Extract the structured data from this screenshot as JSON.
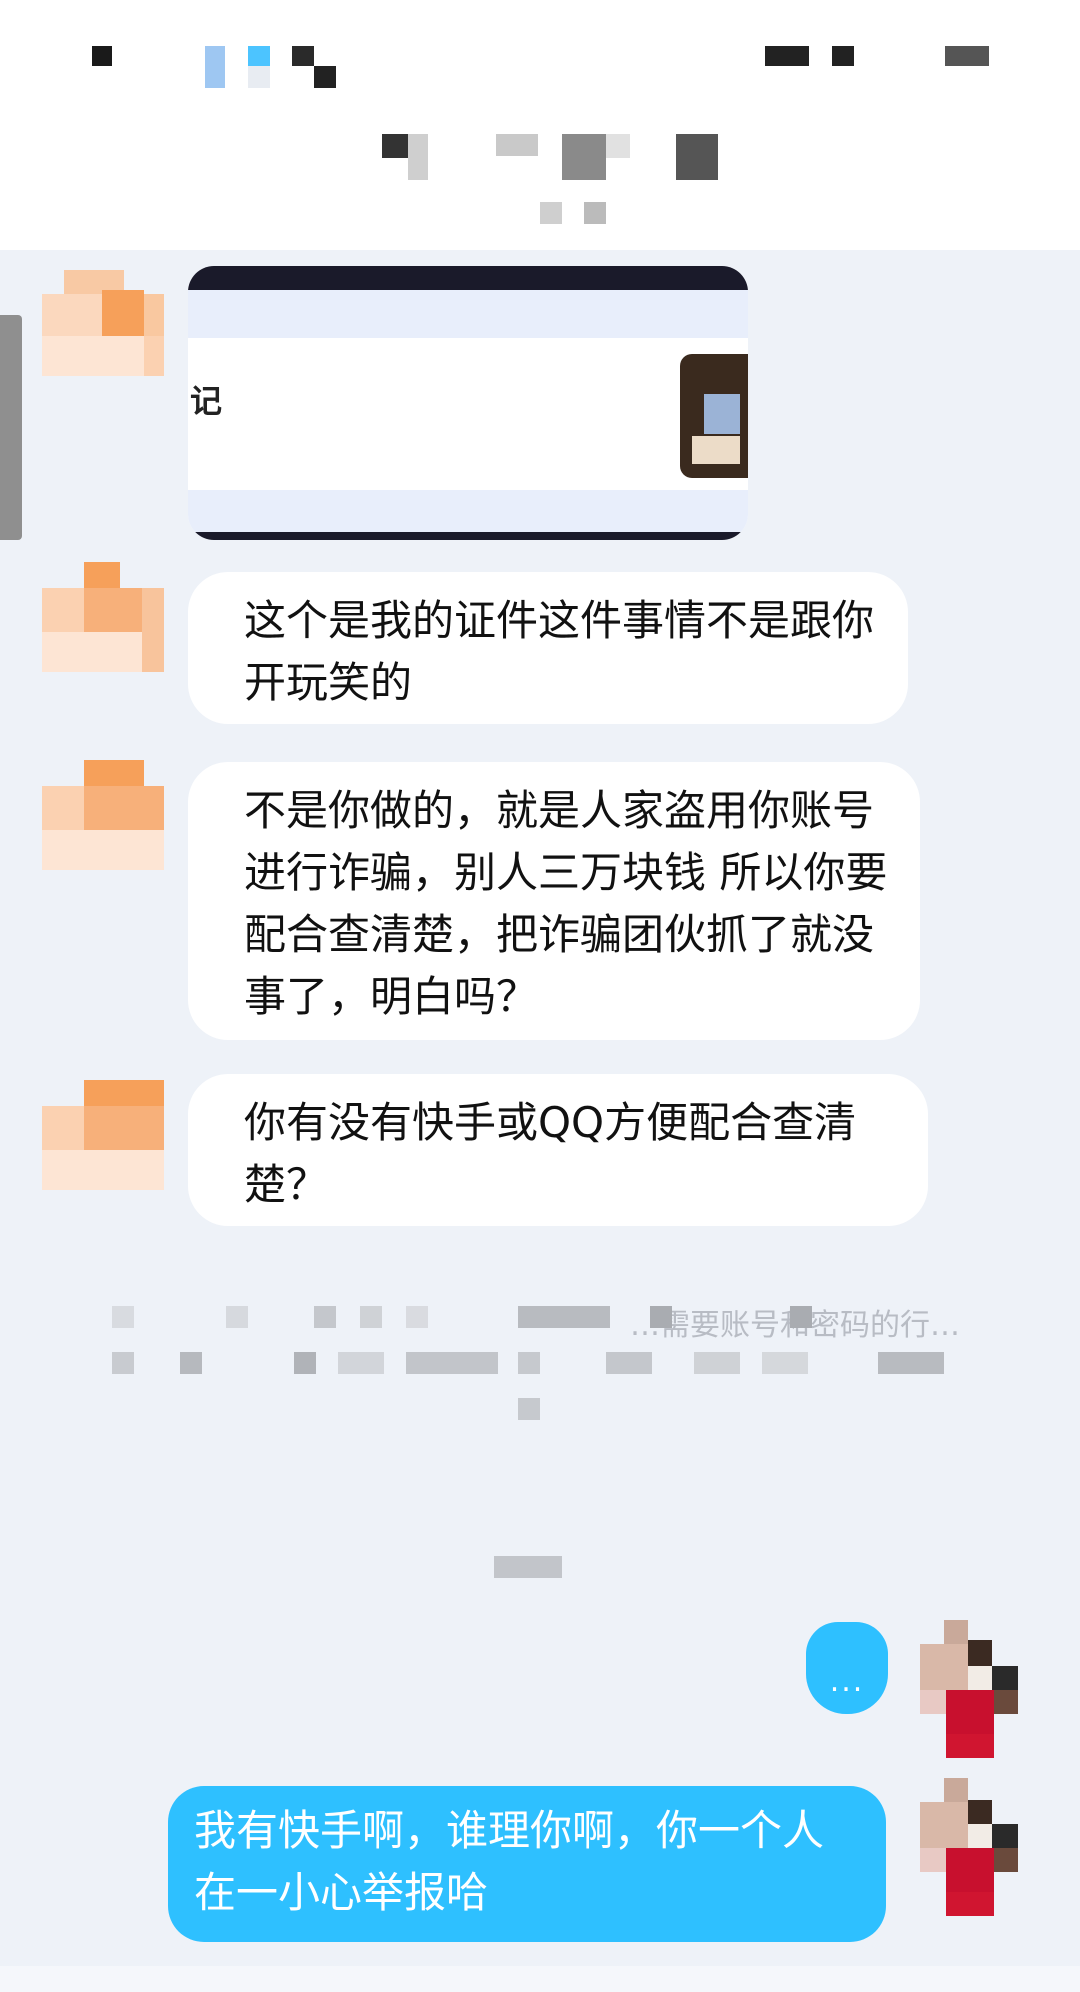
{
  "status_bar": {
    "signal_icon": "signal-icon",
    "battery_icon": "battery-icon"
  },
  "header": {
    "contact_name": "",
    "contact_subtitle": ""
  },
  "messages": {
    "image_card": {
      "caption_fragment": "记"
    },
    "incoming": [
      {
        "text": "这个是我的证件这件事情不是跟你开玩笑的"
      },
      {
        "text": "不是你做的，就是人家盗用你账号进行诈骗，别人三万块钱 所以你要配合查清楚，把诈骗团伙抓了就没事了，明白吗？"
      },
      {
        "text": "你有没有快手或QQ方便配合查清楚？"
      }
    ],
    "system_notice": {
      "visible_fragment": "…需要账号和密码的行…"
    },
    "typing_indicator": "...",
    "outgoing": [
      {
        "text": "我有快手啊，谁理你啊，你一个人在一小心举报哈"
      }
    ]
  },
  "colors": {
    "incoming_bubble": "#ffffff",
    "outgoing_bubble": "#2ec0ff",
    "background": "#eef2f8",
    "avatar_accent": "#f6a05a"
  }
}
